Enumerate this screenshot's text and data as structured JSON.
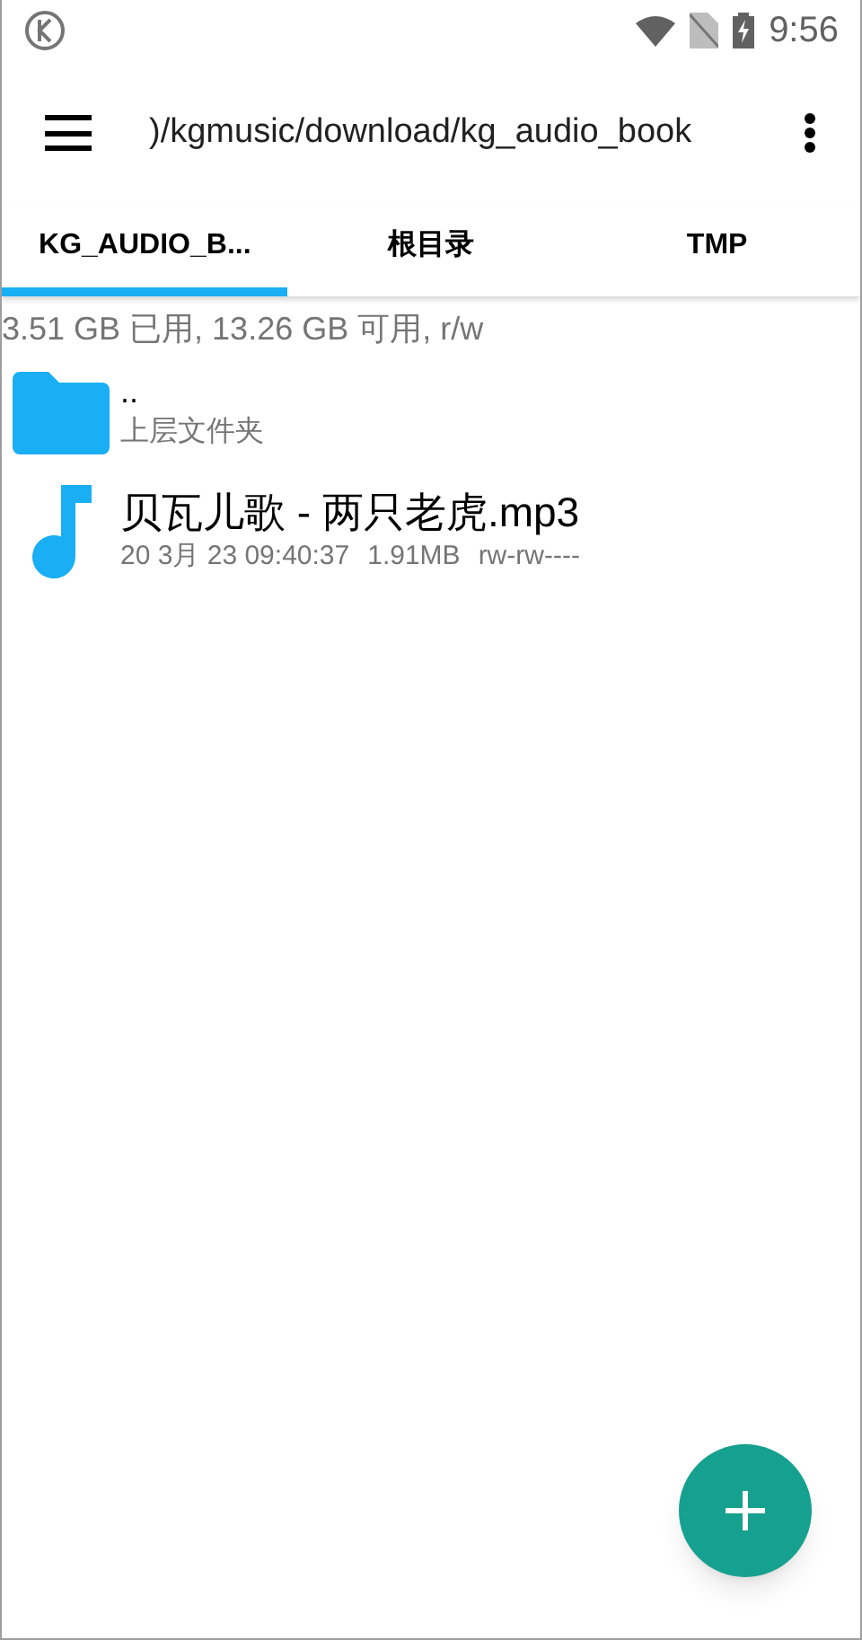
{
  "status_bar": {
    "time": "9:56"
  },
  "toolbar": {
    "path": ")/kgmusic/download/kg_audio_book"
  },
  "tabs": [
    {
      "label": "KG_AUDIO_B...",
      "selected": true
    },
    {
      "label": "根目录",
      "selected": false
    },
    {
      "label": "TMP",
      "selected": false
    }
  ],
  "storage_info": "3.51 GB 已用, 13.26 GB 可用, r/w",
  "files": [
    {
      "kind": "folder",
      "name": "..",
      "subtitle": "上层文件夹"
    },
    {
      "kind": "audio",
      "name": "贝瓦儿歌 - 两只老虎.mp3",
      "date": "20 3月 23 09:40:37",
      "size": "1.91MB",
      "permissions": "rw-rw----"
    }
  ]
}
